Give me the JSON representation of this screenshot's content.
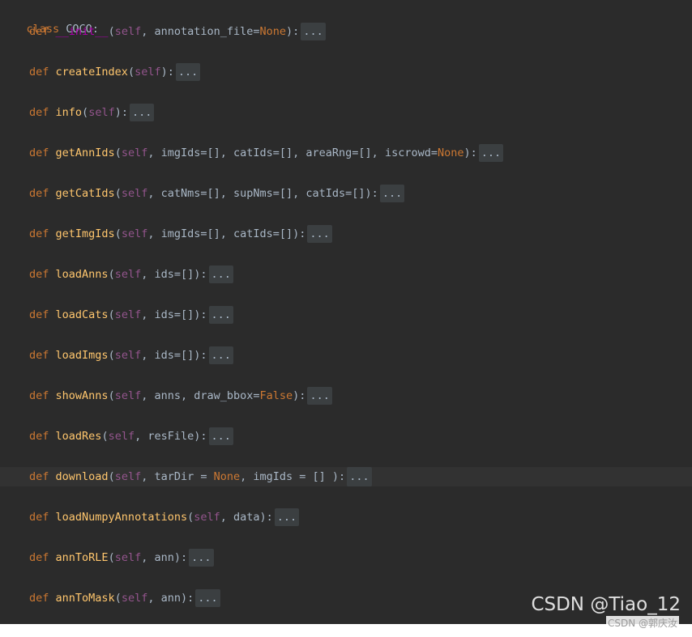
{
  "code": {
    "class_kw": "class",
    "class_name": "COCO:",
    "def_kw": "def",
    "self_kw": "self",
    "fold": "...",
    "lines": [
      {
        "name": "__init__",
        "params": [
          "self",
          ", annotation_file=",
          "None",
          "):"
        ]
      },
      {
        "name": "createIndex",
        "params": [
          "self",
          "):"
        ]
      },
      {
        "name": "info",
        "params": [
          "self",
          "):"
        ]
      },
      {
        "name": "getAnnIds",
        "params": [
          "self",
          ", imgIds=[], catIds=[], areaRng=[], iscrowd=",
          "None",
          "):"
        ]
      },
      {
        "name": "getCatIds",
        "params": [
          "self",
          ", catNms=[], supNms=[], catIds=[]):"
        ]
      },
      {
        "name": "getImgIds",
        "params": [
          "self",
          ", imgIds=[], catIds=[]):"
        ]
      },
      {
        "name": "loadAnns",
        "params": [
          "self",
          ", ids=[]):"
        ]
      },
      {
        "name": "loadCats",
        "params": [
          "self",
          ", ids=[]):"
        ]
      },
      {
        "name": "loadImgs",
        "params": [
          "self",
          ", ids=[]):"
        ]
      },
      {
        "name": "showAnns",
        "params": [
          "self",
          ", anns, draw_bbox=",
          "False",
          "):"
        ]
      },
      {
        "name": "loadRes",
        "params": [
          "self",
          ", resFile):"
        ]
      },
      {
        "name": "download",
        "params": [
          "self",
          ", tarDir = ",
          "None",
          ", imgIds = [] ):"
        ]
      },
      {
        "name": "loadNumpyAnnotations",
        "params": [
          "self",
          ", data):"
        ]
      },
      {
        "name": "annToRLE",
        "params": [
          "self",
          ", ann):"
        ]
      },
      {
        "name": "annToMask",
        "params": [
          "self",
          ", ann):"
        ]
      }
    ]
  },
  "watermark": {
    "main": "CSDN @Tiao_12",
    "sub": "CSDN @郭庆汝"
  },
  "colors": {
    "background": "#2b2b2b",
    "keyword": "#cc7832",
    "function": "#ffc66d",
    "self": "#94558d",
    "text": "#a9b7c6"
  }
}
